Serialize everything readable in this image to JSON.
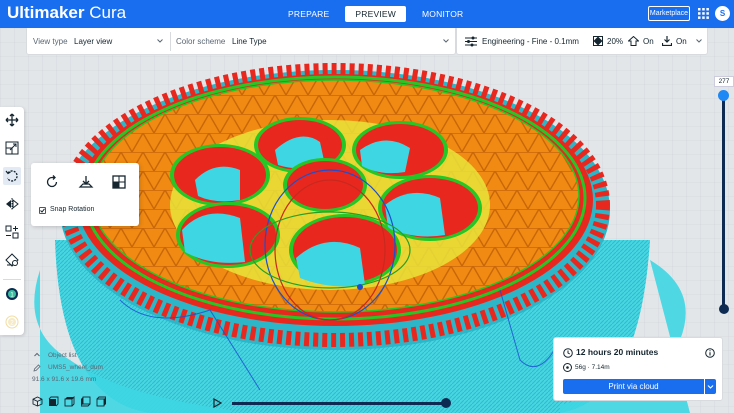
{
  "app": {
    "name_bold": "Ultimaker",
    "name_light": " Cura"
  },
  "stages": [
    {
      "label": "PREPARE",
      "active": false
    },
    {
      "label": "PREVIEW",
      "active": true
    },
    {
      "label": "MONITOR",
      "active": false
    }
  ],
  "header": {
    "marketplace_label": "Marketplace",
    "avatar_initial": "S"
  },
  "view_panel": {
    "view_type_label": "View type",
    "view_type_value": "Layer view",
    "color_scheme_label": "Color scheme",
    "color_scheme_value": "Line Type"
  },
  "print_settings": {
    "profile": "Engineering - Fine - 0.1mm",
    "infill": "20%",
    "support": "On",
    "adhesion": "On"
  },
  "toolbar": {
    "tools": [
      "move-tool",
      "scale-tool",
      "rotate-tool",
      "mirror-tool",
      "per-model-settings-tool",
      "support-blocker-tool"
    ],
    "extruders": [
      "1",
      "2"
    ],
    "active_tool": "rotate-tool"
  },
  "rotate_panel": {
    "snap_rotation_label": "Snap Rotation",
    "snap_rotation_checked": true
  },
  "layer_slider": {
    "current_layer": "277",
    "level": 1.0
  },
  "object_info": {
    "object_list_label": "Object list",
    "object_name": "UMS5_wheel_dum",
    "dimensions": "91.6 x 91.6 x 19.6 mm"
  },
  "simulation": {
    "progress": 1.0
  },
  "print_panel": {
    "time": "12 hours 20 minutes",
    "material": "56g · 7.14m",
    "button_label": "Print via cloud"
  },
  "colors": {
    "brand_blue": "#196ef0",
    "wall_red": "#e8281e",
    "infill_orange": "#f08a12",
    "support_cyan": "#3ed6e3",
    "skin_yellow": "#e9e43a",
    "inner_wall_green": "#25c625",
    "travel_blue": "#1a4fd0"
  }
}
